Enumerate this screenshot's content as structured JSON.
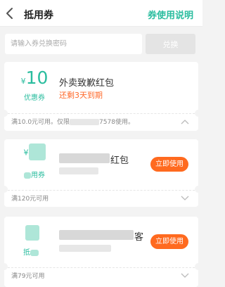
{
  "header": {
    "title": "抵用券",
    "help_link": "券使用说明",
    "back_icon": "chevron-left-icon"
  },
  "redeem": {
    "placeholder": "请输入券兑换密码",
    "button_label": "兑换"
  },
  "coupons": [
    {
      "currency": "¥",
      "amount": "10",
      "type_label": "优惠券",
      "title": "外卖致歉红包",
      "expiry_note": "还剩3天到期",
      "footer_prefix": "满10.0元可用。仅限",
      "footer_suffix": "7578使用。",
      "expanded": true
    },
    {
      "currency": "¥",
      "title_suffix": "红包",
      "type_label_tail": "用券",
      "button_label": "立即使用",
      "footer": "满120元可用",
      "expanded": false
    },
    {
      "title_suffix": "客",
      "type_label_head": "抵",
      "button_label": "立即使用",
      "footer": "满79元可用",
      "expanded": false
    }
  ],
  "colors": {
    "accent": "#2bbd9f",
    "warning": "#ff6a2b",
    "button": "#ff6a1f",
    "background": "#f3f3f3"
  }
}
